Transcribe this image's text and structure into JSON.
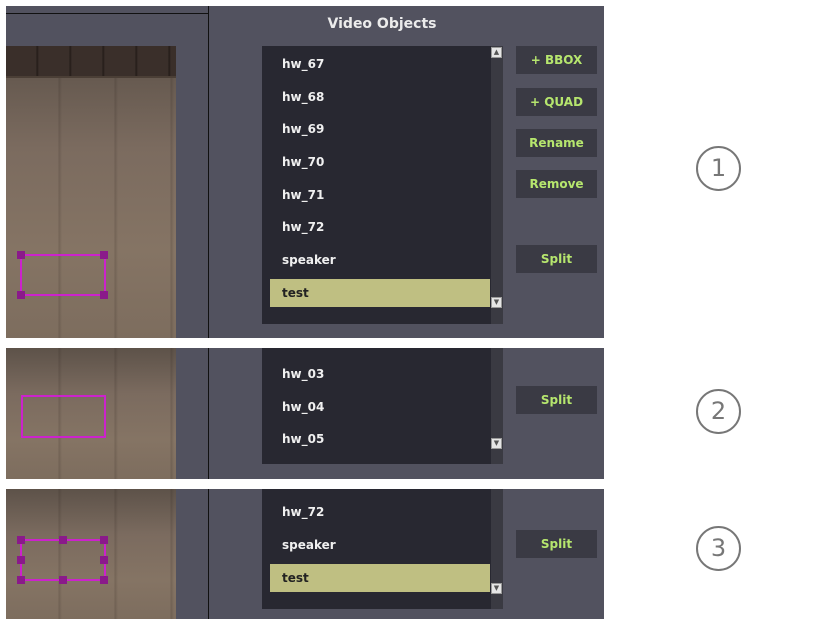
{
  "panel1": {
    "title": "Video Objects",
    "objects": [
      "hw_67",
      "hw_68",
      "hw_69",
      "hw_70",
      "hw_71",
      "hw_72",
      "speaker",
      "test"
    ],
    "selected": "test",
    "buttons": {
      "add_bbox": "+ BBOX",
      "add_quad": "+ QUAD",
      "rename": "Rename",
      "remove": "Remove",
      "split": "Split"
    }
  },
  "panel2": {
    "objects": [
      "hw_03",
      "hw_04",
      "hw_05"
    ],
    "buttons": {
      "split": "Split"
    }
  },
  "panel3": {
    "objects": [
      "hw_72",
      "speaker",
      "test"
    ],
    "selected": "test",
    "buttons": {
      "split": "Split"
    }
  },
  "callouts": [
    "1",
    "2",
    "3"
  ],
  "icons": {
    "scroll_up": "scroll-up-arrow-icon",
    "scroll_down": "scroll-down-arrow-icon",
    "handle": "resize-handle-icon"
  },
  "colors": {
    "panel_bg": "#52525f",
    "list_bg": "#282831",
    "selection": "#bfbf82",
    "button_text": "#b6e66e",
    "bbox": "#cc22cc"
  }
}
